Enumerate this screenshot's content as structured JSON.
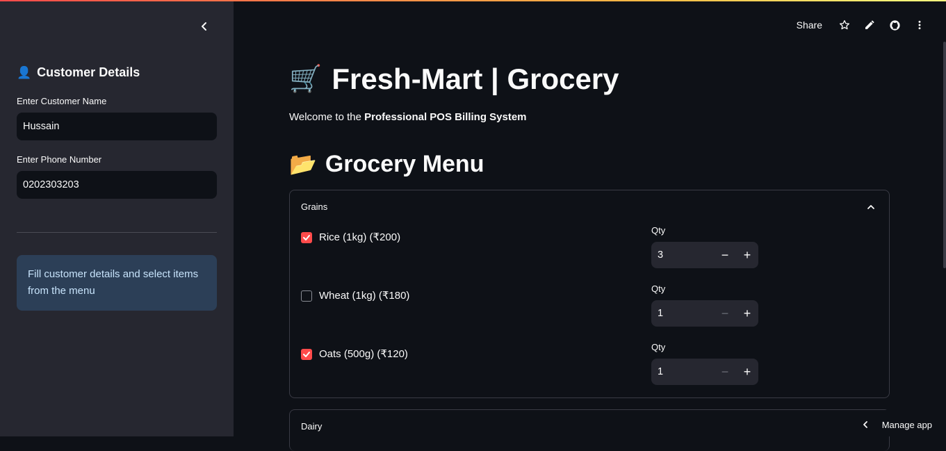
{
  "header": {
    "share_label": "Share",
    "icons": [
      "star-icon",
      "pencil-icon",
      "github-icon",
      "more-vert-icon"
    ]
  },
  "sidebar": {
    "title_icon": "👤",
    "title": "Customer Details",
    "name_label": "Enter Customer Name",
    "name_value": "Hussain",
    "phone_label": "Enter Phone Number",
    "phone_value": "0202303203",
    "info_text": "Fill customer details and select items from the menu"
  },
  "main": {
    "title_icon": "🛒",
    "title": "Fresh-Mart | Grocery",
    "welcome_prefix": "Welcome to the ",
    "welcome_bold": "Professional POS Billing System",
    "menu_icon": "📂",
    "menu_title": "Grocery Menu",
    "sections": [
      {
        "name": "Grains",
        "expanded": true,
        "items": [
          {
            "label": "Rice (1kg) (₹200)",
            "checked": true,
            "qty_label": "Qty",
            "qty": "3"
          },
          {
            "label": "Wheat (1kg) (₹180)",
            "checked": false,
            "qty_label": "Qty",
            "qty": "1"
          },
          {
            "label": "Oats (500g) (₹120)",
            "checked": true,
            "qty_label": "Qty",
            "qty": "1"
          }
        ]
      },
      {
        "name": "Dairy",
        "expanded": false
      }
    ]
  },
  "manage_app": {
    "label": "Manage app"
  },
  "colors": {
    "accent": "#ff4b4b",
    "sidebar_bg": "#262730",
    "main_bg": "#0e1117",
    "info_bg": "#2c3f57"
  }
}
